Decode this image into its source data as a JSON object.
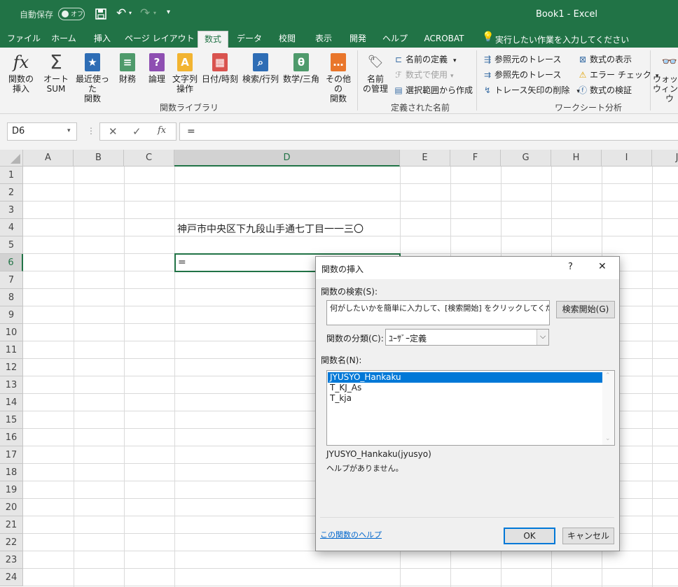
{
  "titlebar": {
    "autosave_label": "自動保存",
    "autosave_state": "オフ",
    "title": "Book1  -  Excel"
  },
  "tabs": [
    "ファイル",
    "ホーム",
    "挿入",
    "ページ レイアウト",
    "数式",
    "データ",
    "校閲",
    "表示",
    "開発",
    "ヘルプ",
    "ACROBAT"
  ],
  "tell_me": "実行したい作業を入力してください",
  "ribbon": {
    "insert_function": "関数の\n挿入",
    "autosum": "オート\nSUM",
    "recent": "最近使った\n関数",
    "financial": "財務",
    "logical": "論理",
    "text": "文字列\n操作",
    "datetime": "日付/時刻",
    "lookup": "検索/行列",
    "math": "数学/三角",
    "more": "その他の\n関数",
    "group_library": "関数ライブラリ",
    "name_manager": "名前\nの管理",
    "define_name": "名前の定義",
    "use_in_formula": "数式で使用",
    "create_from_selection": "選択範囲から作成",
    "group_names": "定義された名前",
    "trace_precedents": "参照元のトレース",
    "trace_dependents": "参照先のトレース",
    "remove_arrows": "トレース矢印の削除",
    "show_formulas": "数式の表示",
    "error_checking": "エラー チェック",
    "evaluate_formula": "数式の検証",
    "group_auditing": "ワークシート分析",
    "watch_window": "ウォッチ\nウィンドウ"
  },
  "formula_bar": {
    "name_box": "D6",
    "formula": "="
  },
  "columns": [
    "A",
    "B",
    "C",
    "D",
    "E",
    "F",
    "G",
    "H",
    "I",
    "J"
  ],
  "rows": [
    "1",
    "2",
    "3",
    "4",
    "5",
    "6",
    "7",
    "8",
    "9",
    "10",
    "11",
    "12",
    "13",
    "14",
    "15",
    "16",
    "17",
    "18",
    "19",
    "20",
    "21",
    "22",
    "23",
    "24"
  ],
  "cells": {
    "D4": "神戸市中央区下九段山手通七丁目一一三〇",
    "D6": "="
  },
  "dialog": {
    "title": "関数の挿入",
    "help_glyph": "?",
    "close_glyph": "✕",
    "search_label": "関数の検索(S):",
    "search_placeholder": "何がしたいかを簡単に入力して、[検索開始] をクリックしてください。",
    "search_button": "検索開始(G)",
    "category_label": "関数の分類(C):",
    "category_value": "ﾕｰｻﾞｰ定義",
    "function_name_label": "関数名(N):",
    "functions": [
      "JYUSYO_Hankaku",
      "T_KJ_As",
      "T_kja"
    ],
    "selected_function": "JYUSYO_Hankaku",
    "signature": "JYUSYO_Hankaku(jyusyo)",
    "description": "ヘルプがありません。",
    "help_link": "この関数のヘルプ",
    "ok_button": "OK",
    "cancel_button": "キャンセル"
  },
  "colors": {
    "excel_green": "#217346",
    "selection_blue": "#0078d7",
    "link_blue": "#0066cc"
  }
}
